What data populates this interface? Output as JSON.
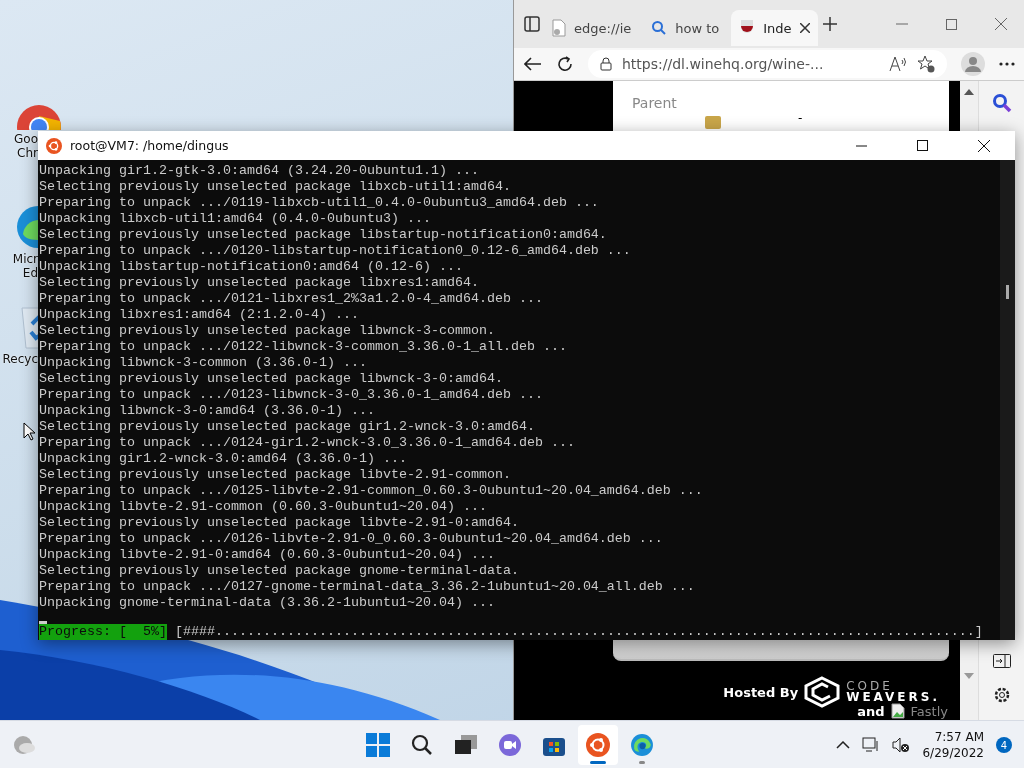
{
  "desktop_icons": [
    {
      "kind": "chrome",
      "lines": [
        "Goo",
        "Chr"
      ]
    },
    {
      "kind": "edge",
      "lines": [
        "Micr",
        "Ed"
      ]
    },
    {
      "kind": "recycle",
      "lines": [
        "Recyc"
      ]
    }
  ],
  "browser": {
    "tabs": [
      {
        "kind": "page",
        "label": "edge://ie",
        "selected": false
      },
      {
        "kind": "search",
        "label": "how to",
        "selected": false
      },
      {
        "kind": "wine",
        "label": "Inde",
        "selected": true
      }
    ],
    "address": "https://dl.winehq.org/wine-...",
    "page": {
      "parent": "Parent",
      "dash": "-",
      "hosted_by": "Hosted By",
      "code": "CODE",
      "weavers": "WEAVERS.",
      "and": "and",
      "fastly": "Fastly"
    }
  },
  "terminal": {
    "title": "root@VM7: /home/dingus",
    "lines": [
      "Unpacking gir1.2-gtk-3.0:amd64 (3.24.20-0ubuntu1.1) ...",
      "Selecting previously unselected package libxcb-util1:amd64.",
      "Preparing to unpack .../0119-libxcb-util1_0.4.0-0ubuntu3_amd64.deb ...",
      "Unpacking libxcb-util1:amd64 (0.4.0-0ubuntu3) ...",
      "Selecting previously unselected package libstartup-notification0:amd64.",
      "Preparing to unpack .../0120-libstartup-notification0_0.12-6_amd64.deb ...",
      "Unpacking libstartup-notification0:amd64 (0.12-6) ...",
      "Selecting previously unselected package libxres1:amd64.",
      "Preparing to unpack .../0121-libxres1_2%3a1.2.0-4_amd64.deb ...",
      "Unpacking libxres1:amd64 (2:1.2.0-4) ...",
      "Selecting previously unselected package libwnck-3-common.",
      "Preparing to unpack .../0122-libwnck-3-common_3.36.0-1_all.deb ...",
      "Unpacking libwnck-3-common (3.36.0-1) ...",
      "Selecting previously unselected package libwnck-3-0:amd64.",
      "Preparing to unpack .../0123-libwnck-3-0_3.36.0-1_amd64.deb ...",
      "Unpacking libwnck-3-0:amd64 (3.36.0-1) ...",
      "Selecting previously unselected package gir1.2-wnck-3.0:amd64.",
      "Preparing to unpack .../0124-gir1.2-wnck-3.0_3.36.0-1_amd64.deb ...",
      "Unpacking gir1.2-wnck-3.0:amd64 (3.36.0-1) ...",
      "Selecting previously unselected package libvte-2.91-common.",
      "Preparing to unpack .../0125-libvte-2.91-common_0.60.3-0ubuntu1~20.04_amd64.deb ...",
      "Unpacking libvte-2.91-common (0.60.3-0ubuntu1~20.04) ...",
      "Selecting previously unselected package libvte-2.91-0:amd64.",
      "Preparing to unpack .../0126-libvte-2.91-0_0.60.3-0ubuntu1~20.04_amd64.deb ...",
      "Unpacking libvte-2.91-0:amd64 (0.60.3-0ubuntu1~20.04) ...",
      "Selecting previously unselected package gnome-terminal-data.",
      "Preparing to unpack .../0127-gnome-terminal-data_3.36.2-1ubuntu1~20.04_all.deb ...",
      "Unpacking gnome-terminal-data (3.36.2-1ubuntu1~20.04) ..."
    ],
    "progress_label": "Progress: [  5%]",
    "progress_bar": "[####...............................................................................................]"
  },
  "taskbar": {
    "items": [
      {
        "kind": "start",
        "selected": false
      },
      {
        "kind": "search",
        "selected": false
      },
      {
        "kind": "taskview",
        "selected": false
      },
      {
        "kind": "chat",
        "selected": false
      },
      {
        "kind": "store",
        "selected": false
      },
      {
        "kind": "ubuntu",
        "selected": true
      },
      {
        "kind": "edge",
        "selected": false
      }
    ],
    "time": "7:57 AM",
    "date": "6/29/2022",
    "notifications": "4"
  }
}
